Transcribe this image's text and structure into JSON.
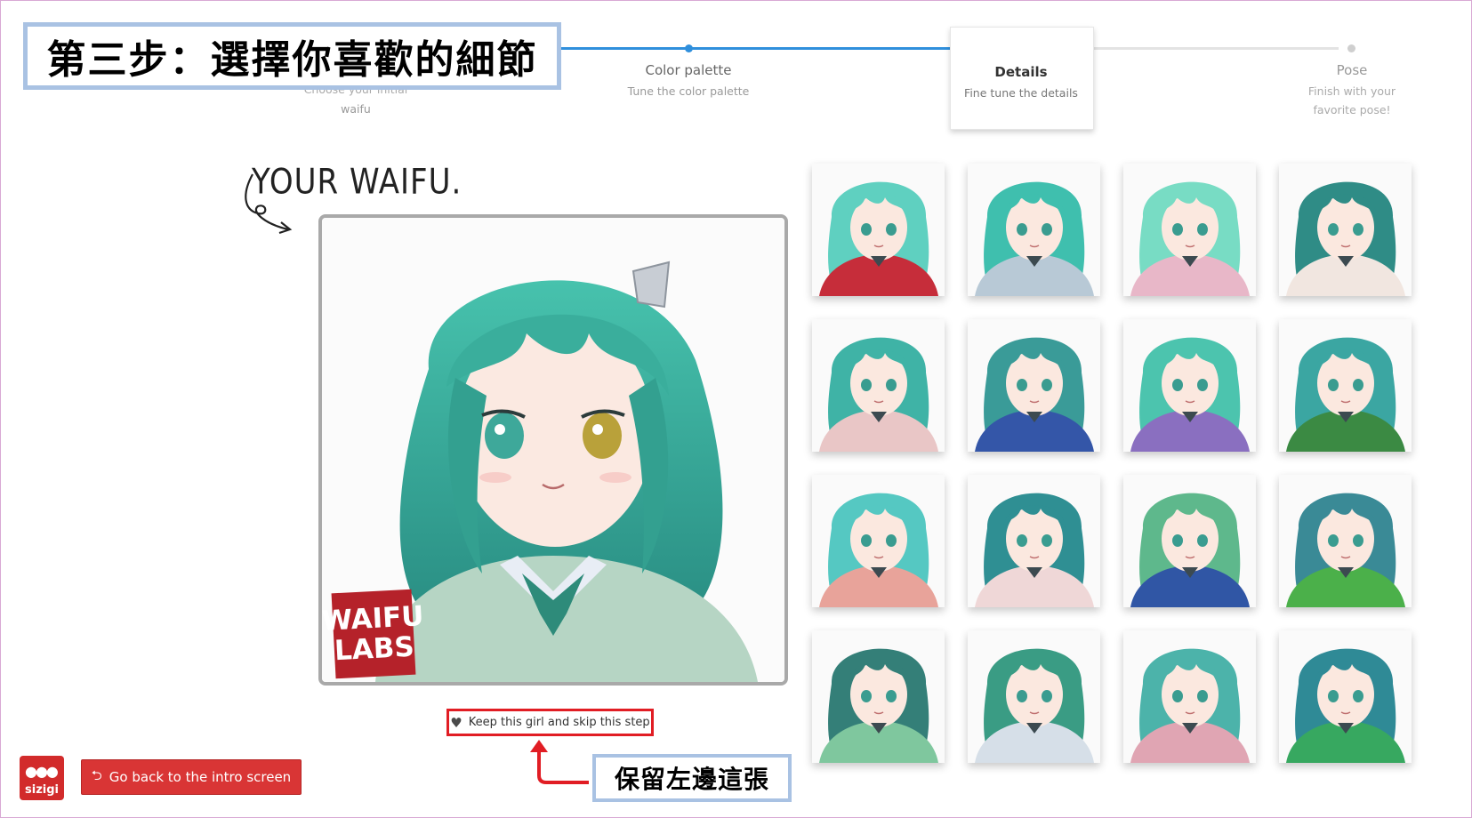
{
  "annotation": {
    "title": "第三步：選擇你喜歡的細節",
    "keep_hint": "保留左邊這張"
  },
  "stepper": {
    "steps": [
      {
        "label": "",
        "sub": "waifu",
        "sub_partial": "Choose your initial",
        "state": "done"
      },
      {
        "label": "Color palette",
        "sub": "Tune the color palette",
        "state": "done"
      },
      {
        "label": "Details",
        "sub": "Fine tune the details",
        "state": "active"
      },
      {
        "label": "Pose",
        "sub1": "Finish with your",
        "sub2": "favorite pose!",
        "state": "pending"
      }
    ]
  },
  "preview": {
    "caption": "YOUR WAIFU.",
    "stamp_line1": "WAIFU",
    "stamp_line2": "LABS",
    "hair_color": "#3fb3a0",
    "keep_button": "Keep this girl and skip this step",
    "keep_icon": "heart-icon"
  },
  "footer": {
    "brand": "sizigi",
    "back_button": "Go back to the intro screen",
    "back_icon": "undo-arrow-icon"
  },
  "colors": {
    "accent": "#2f8fdc",
    "danger": "#d93535",
    "annotation_border": "#a9c2e3"
  },
  "grid": {
    "rows": 4,
    "cols": 4,
    "thumbs": [
      {
        "hair": "#5fd0c0",
        "outfit": "#c62d3a"
      },
      {
        "hair": "#3fbfae",
        "outfit": "#b8c9d6"
      },
      {
        "hair": "#78dcc4",
        "outfit": "#e8b7c8"
      },
      {
        "hair": "#2f8c86",
        "outfit": "#f1e6e0"
      },
      {
        "hair": "#3fb3a6",
        "outfit": "#e9c6c6"
      },
      {
        "hair": "#3a9b98",
        "outfit": "#3456a8"
      },
      {
        "hair": "#4cc4ae",
        "outfit": "#8a6fc0"
      },
      {
        "hair": "#3ba6a2",
        "outfit": "#3b8a43"
      },
      {
        "hair": "#55c8c2",
        "outfit": "#e8a39a"
      },
      {
        "hair": "#2f8f93",
        "outfit": "#efd7d7"
      },
      {
        "hair": "#5eb88c",
        "outfit": "#3056a5"
      },
      {
        "hair": "#3a8a96",
        "outfit": "#4bb04a"
      },
      {
        "hair": "#347f78",
        "outfit": "#7fc79e"
      },
      {
        "hair": "#3a9c84",
        "outfit": "#d6dfe8"
      },
      {
        "hair": "#4cb3aa",
        "outfit": "#e0a5b3"
      },
      {
        "hair": "#2f8a96",
        "outfit": "#37a860"
      }
    ]
  }
}
